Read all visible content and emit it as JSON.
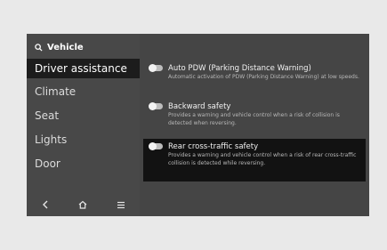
{
  "search": {
    "icon": "search-icon",
    "label": "Vehicle"
  },
  "sidebar": {
    "items": [
      {
        "label": "Driver assistance",
        "active": true
      },
      {
        "label": "Climate"
      },
      {
        "label": "Seat"
      },
      {
        "label": "Lights"
      },
      {
        "label": "Door"
      }
    ]
  },
  "bottom_bar": {
    "icons": [
      "back-icon",
      "home-icon",
      "menu-icon"
    ]
  },
  "options": [
    {
      "title": "Auto PDW (Parking Distance Warning)",
      "description": "Automatic activation of PDW (Parking Distance Warning) at low speeds.",
      "enabled": false
    },
    {
      "title": "Backward safety",
      "description": "Provides a warning and vehicle control when a risk of collision is detected when reversing.",
      "enabled": false
    },
    {
      "title": "Rear cross-traffic safety",
      "description": "Provides a warning and vehicle control when a risk of rear cross-traffic collision is detected while reversing.",
      "enabled": false,
      "selected": true
    }
  ],
  "colors": {
    "screen_bg": "#454545",
    "selected_bg": "#121212",
    "active_nav_bg": "#1c1c1c"
  }
}
